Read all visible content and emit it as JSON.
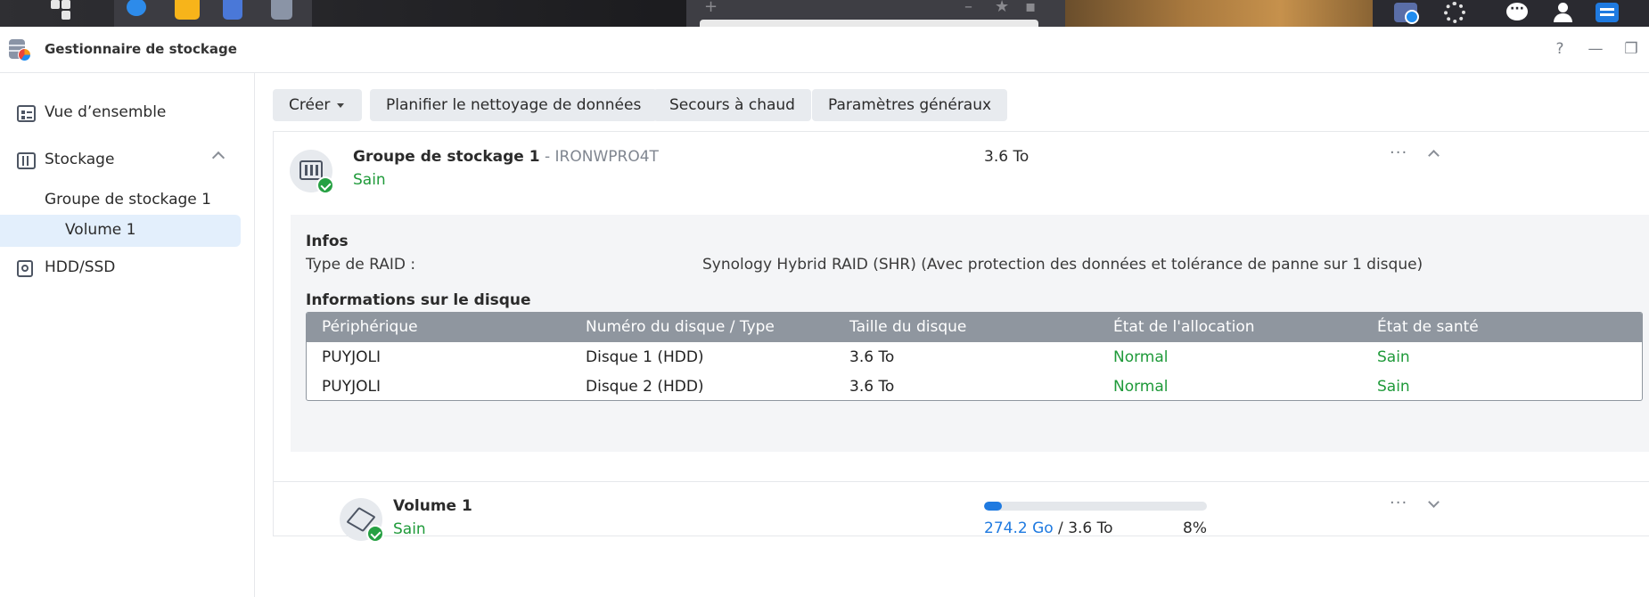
{
  "window": {
    "title": "Gestionnaire de stockage",
    "help_label": "?",
    "minimize_label": "—",
    "restore_label": "❐"
  },
  "sidebar": {
    "overview_label": "Vue d’ensemble",
    "storage_label": "Stockage",
    "pool_label": "Groupe de stockage 1",
    "volume_label": "Volume 1",
    "hdd_label": "HDD/SSD"
  },
  "toolbar": {
    "create_label": "Créer",
    "schedule_label": "Planifier le nettoyage de données",
    "hotspare_label": "Secours à chaud",
    "settings_label": "Paramètres généraux"
  },
  "pool": {
    "name": "Groupe de stockage 1",
    "separator": " - ",
    "model": "IRONWPRO4T",
    "status": "Sain",
    "size": "3.6 To",
    "more_label": "···",
    "info_title": "Infos",
    "raid_label": "Type de RAID :",
    "raid_value": "Synology Hybrid RAID (SHR) (Avec protection des données et tolérance de panne sur 1 disque)",
    "disk_title": "Informations sur le disque",
    "columns": [
      "Périphérique",
      "Numéro du disque / Type",
      "Taille du disque",
      "État de l'allocation",
      "État de santé"
    ],
    "disks": [
      {
        "device": "PUYJOLI",
        "number": "Disque 1 (HDD)",
        "size": "3.6 To",
        "allocation": "Normal",
        "health": "Sain"
      },
      {
        "device": "PUYJOLI",
        "number": "Disque 2 (HDD)",
        "size": "3.6 To",
        "allocation": "Normal",
        "health": "Sain"
      }
    ]
  },
  "volume": {
    "name": "Volume 1",
    "status": "Sain",
    "used": "274.2 Go",
    "separator": " / ",
    "total": "3.6 To",
    "percent_label": "8%",
    "usage_fraction": 0.08,
    "more_label": "···"
  },
  "colors": {
    "accent": "#1f7ae0",
    "healthy": "#1f9a3a",
    "table_header": "#8f969f"
  }
}
